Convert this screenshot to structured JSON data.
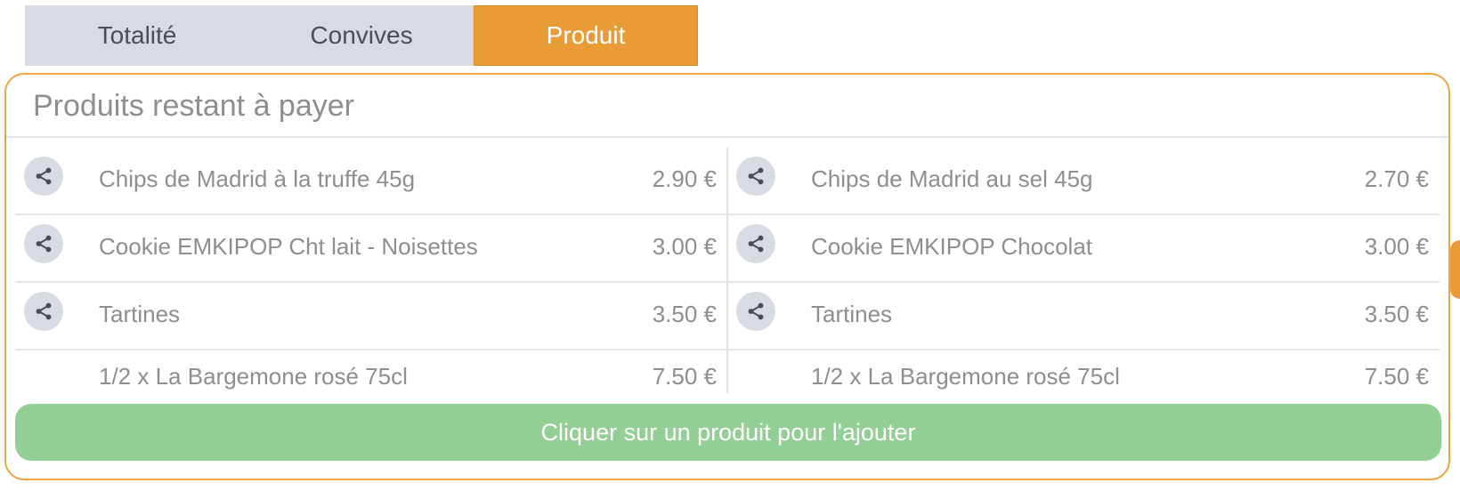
{
  "tabs": [
    {
      "label": "Totalité"
    },
    {
      "label": "Convives"
    },
    {
      "label": "Produit"
    }
  ],
  "active_tab_index": 2,
  "panel": {
    "title": "Produits restant à payer",
    "add_button_label": "Cliquer sur un produit pour l'ajouter"
  },
  "left_items": [
    {
      "name": "Chips de Madrid à la truffe 45g",
      "price": "2.90 €",
      "icon": "share-icon"
    },
    {
      "name": "Cookie EMKIPOP Cht lait - Noisettes",
      "price": "3.00 €",
      "icon": "share-icon"
    },
    {
      "name": "Tartines",
      "price": "3.50 €",
      "icon": "share-icon"
    },
    {
      "name": "1/2 x La Bargemone rosé 75cl",
      "price": "7.50 €"
    }
  ],
  "right_items": [
    {
      "name": "Chips de Madrid au sel 45g",
      "price": "2.70 €",
      "icon": "share-icon"
    },
    {
      "name": "Cookie EMKIPOP Chocolat",
      "price": "3.00 €",
      "icon": "share-icon"
    },
    {
      "name": "Tartines",
      "price": "3.50 €",
      "icon": "share-icon"
    },
    {
      "name": "1/2 x La Bargemone rosé 75cl",
      "price": "7.50 €"
    }
  ],
  "colors": {
    "accent": "#e99b38",
    "tab_inactive": "#d6dce2",
    "button_green": "#93ce95",
    "text_gray": "#8e8e8e"
  }
}
